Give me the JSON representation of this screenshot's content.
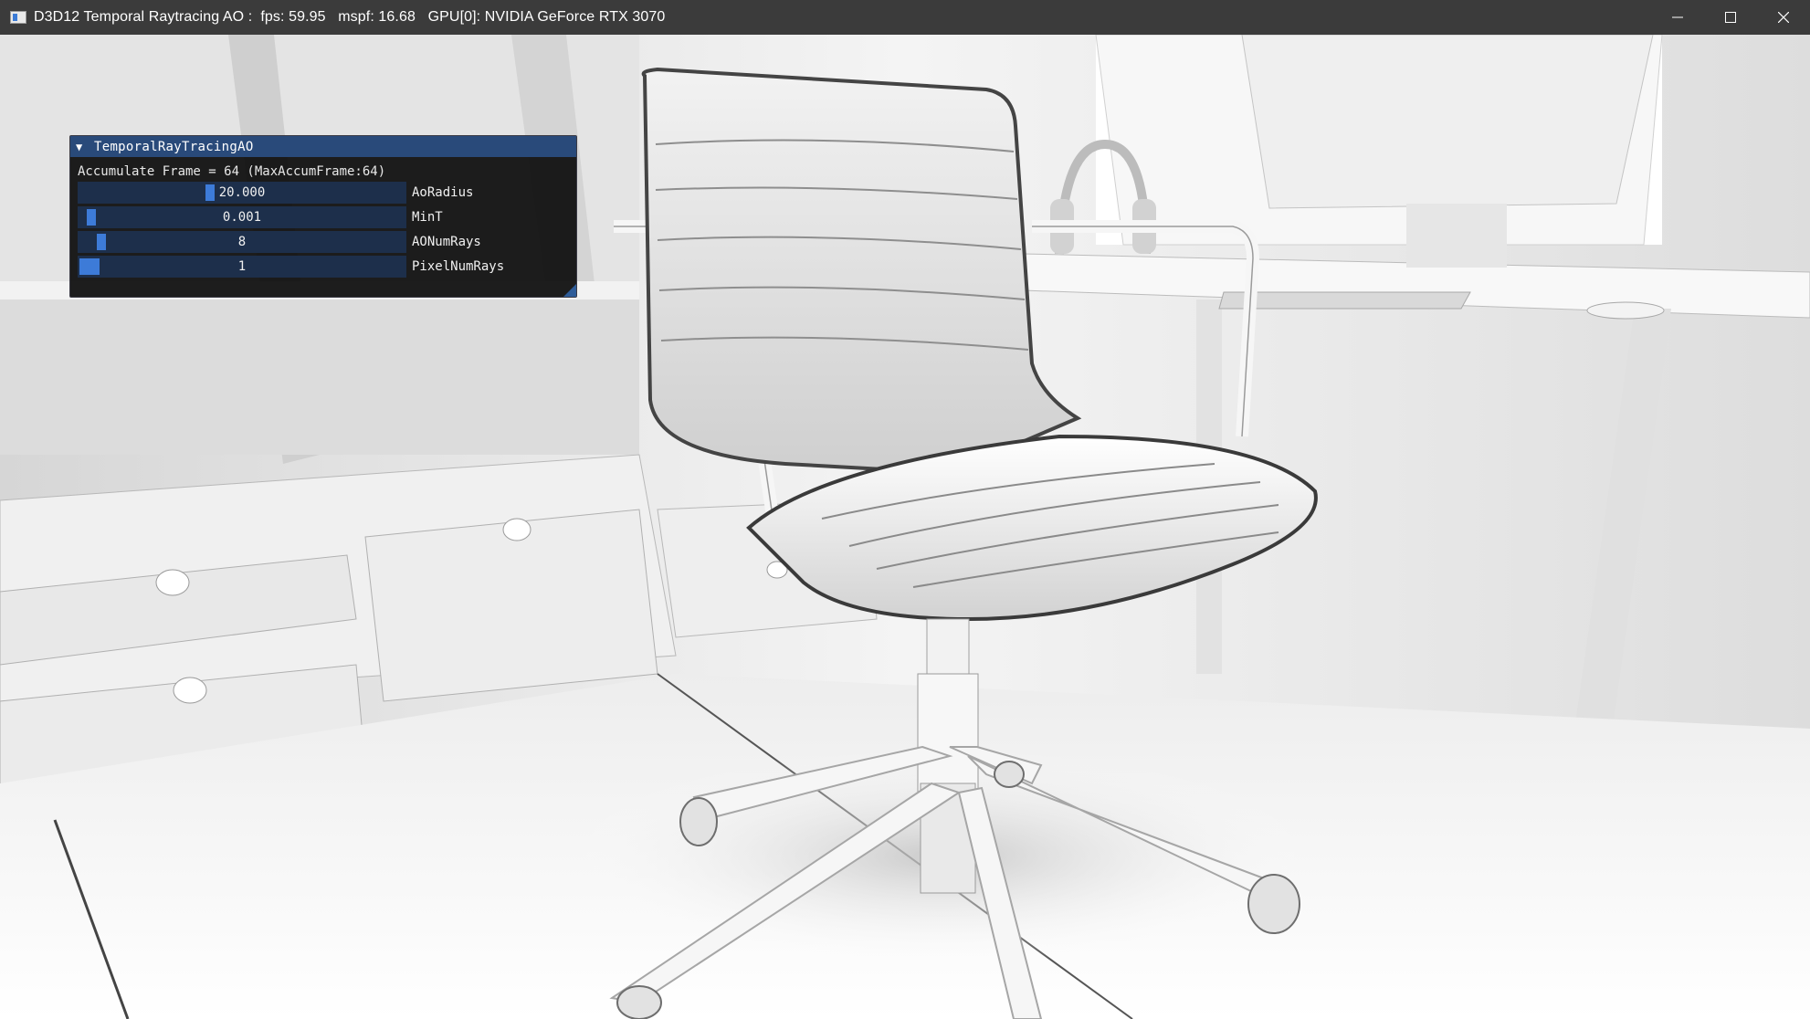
{
  "window": {
    "title": "D3D12 Temporal Raytracing AO :  fps: 59.95   mspf: 16.68   GPU[0]: NVIDIA GeForce RTX 3070",
    "icon": "app-window-icon",
    "controls": [
      "minimize-icon",
      "maximize-icon",
      "close-icon"
    ]
  },
  "panel": {
    "title": "TemporalRayTracingAO",
    "collapse_icon": "triangle-down-icon",
    "accumulate_text": "Accumulate Frame = 64 (MaxAccumFrame:64)",
    "sliders": [
      {
        "label": "AoRadius",
        "value": "20.000"
      },
      {
        "label": "MinT",
        "value": "0.001"
      },
      {
        "label": "AONumRays",
        "value": "8"
      },
      {
        "label": "PixelNumRays",
        "value": "1"
      }
    ]
  },
  "colors": {
    "titlebar": "#3b3b3b",
    "panel_bg": "#0f0f0f",
    "panel_title": "#294a7a",
    "slider_bg": "#1d2f4b",
    "slider_grab": "#3d7bd8"
  }
}
